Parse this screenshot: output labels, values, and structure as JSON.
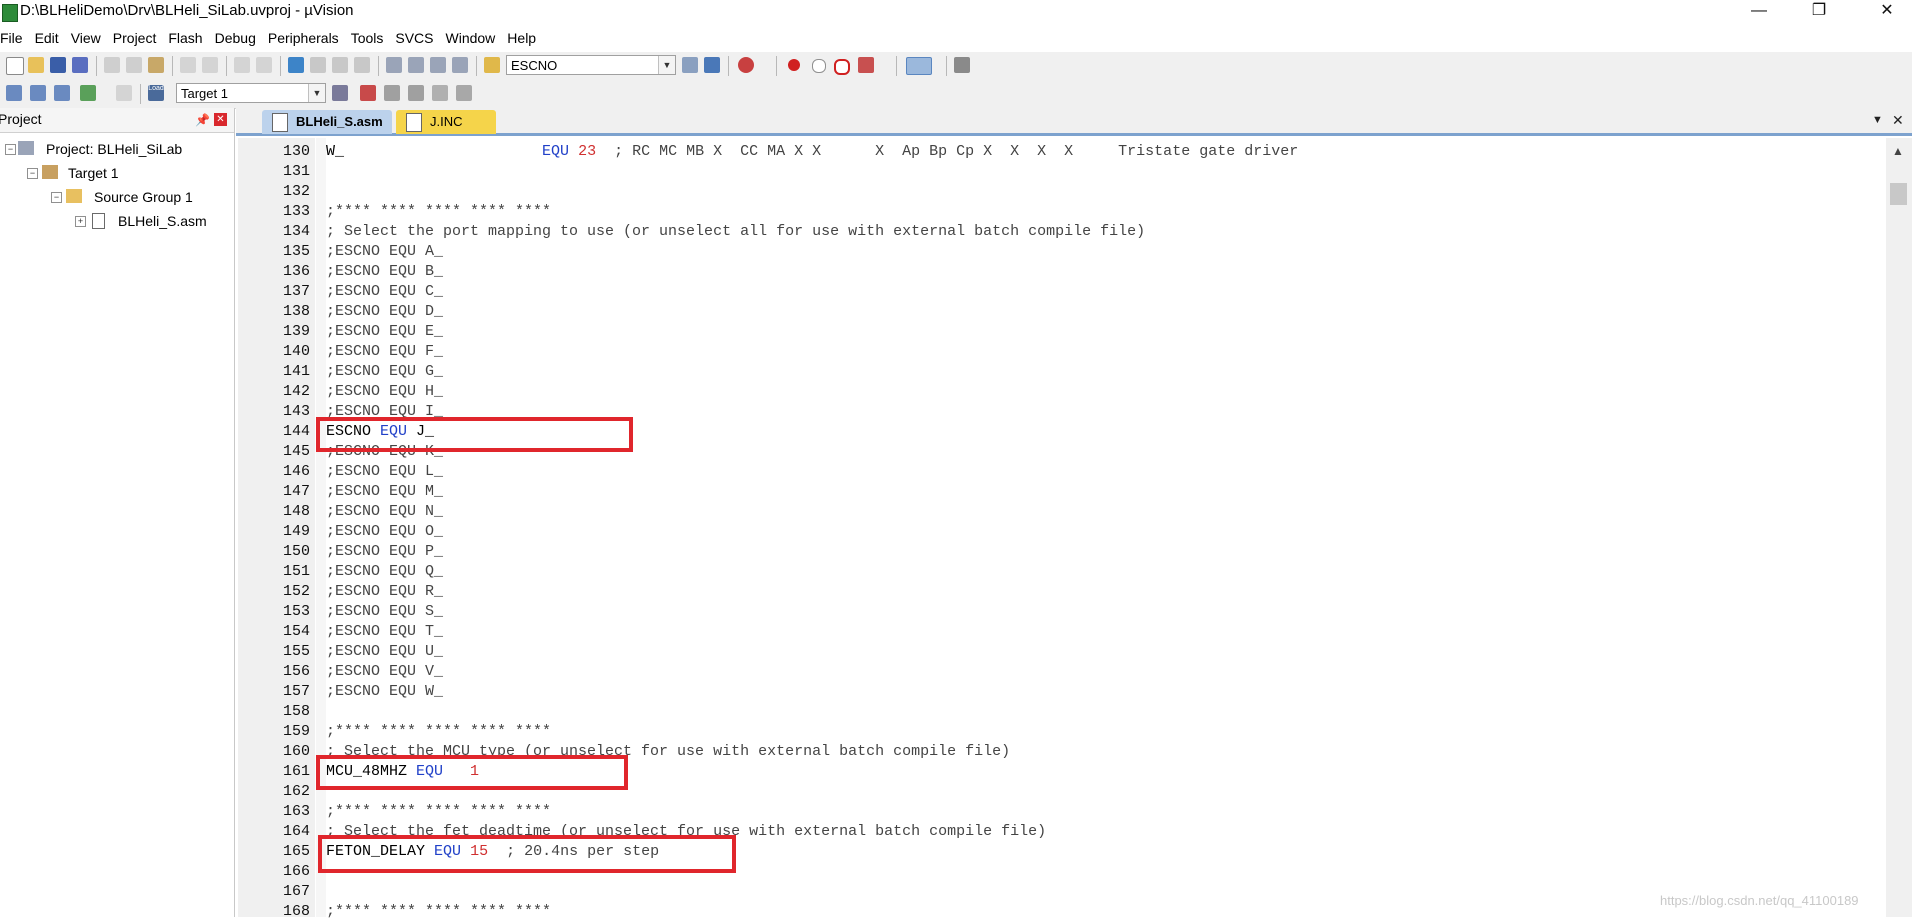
{
  "title": "D:\\BLHeliDemo\\Drv\\BLHeli_SiLab.uvproj - µVision",
  "window_controls": {
    "minimize": "—",
    "maximize": "❐",
    "close": "✕"
  },
  "menu": [
    "File",
    "Edit",
    "View",
    "Project",
    "Flash",
    "Debug",
    "Peripherals",
    "Tools",
    "SVCS",
    "Window",
    "Help"
  ],
  "toolbar1": {
    "find_combo_value": "ESCNO"
  },
  "toolbar2": {
    "load_label": "Load",
    "target_combo_value": "Target 1"
  },
  "project_panel": {
    "title": "Project",
    "pin_icon": "pin-icon",
    "close": "✕",
    "tree": [
      {
        "label": "Project: BLHeli_SiLab",
        "expander": "−"
      },
      {
        "label": "Target 1",
        "expander": "−"
      },
      {
        "label": "Source Group 1",
        "expander": "−"
      },
      {
        "label": "BLHeli_S.asm",
        "expander": "+"
      }
    ]
  },
  "tabs": [
    {
      "label": "BLHeli_S.asm",
      "active": true
    },
    {
      "label": "J.INC",
      "active": false
    }
  ],
  "tab_controls": {
    "dropdown": "▼",
    "close": "✕"
  },
  "code_lines": [
    {
      "n": "130",
      "segs": [
        {
          "t": "W_                      ",
          "c": ""
        },
        {
          "t": "EQU",
          "c": "kw"
        },
        {
          "t": " ",
          "c": ""
        },
        {
          "t": "23",
          "c": "num"
        },
        {
          "t": "  ; RC MC MB X  CC MA X X      X  Ap Bp Cp X  X  X  X     Tristate gate driver",
          "c": "cmt"
        }
      ]
    },
    {
      "n": "131",
      "segs": []
    },
    {
      "n": "132",
      "segs": []
    },
    {
      "n": "133",
      "segs": [
        {
          "t": ";**** **** **** **** ****",
          "c": "cmt"
        }
      ]
    },
    {
      "n": "134",
      "segs": [
        {
          "t": "; Select the port mapping to use (or unselect all for use with external batch compile file)",
          "c": "cmt"
        }
      ]
    },
    {
      "n": "135",
      "segs": [
        {
          "t": ";ESCNO EQU A_",
          "c": "cmt"
        }
      ]
    },
    {
      "n": "136",
      "segs": [
        {
          "t": ";ESCNO EQU B_",
          "c": "cmt"
        }
      ]
    },
    {
      "n": "137",
      "segs": [
        {
          "t": ";ESCNO EQU C_",
          "c": "cmt"
        }
      ]
    },
    {
      "n": "138",
      "segs": [
        {
          "t": ";ESCNO EQU D_",
          "c": "cmt"
        }
      ]
    },
    {
      "n": "139",
      "segs": [
        {
          "t": ";ESCNO EQU E_",
          "c": "cmt"
        }
      ]
    },
    {
      "n": "140",
      "segs": [
        {
          "t": ";ESCNO EQU F_",
          "c": "cmt"
        }
      ]
    },
    {
      "n": "141",
      "segs": [
        {
          "t": ";ESCNO EQU G_",
          "c": "cmt"
        }
      ]
    },
    {
      "n": "142",
      "segs": [
        {
          "t": ";ESCNO EQU H_",
          "c": "cmt"
        }
      ]
    },
    {
      "n": "143",
      "segs": [
        {
          "t": ";ESCNO EQU I_",
          "c": "cmt"
        }
      ]
    },
    {
      "n": "144",
      "segs": [
        {
          "t": "ESCNO ",
          "c": ""
        },
        {
          "t": "EQU",
          "c": "kw"
        },
        {
          "t": " J_",
          "c": ""
        }
      ]
    },
    {
      "n": "145",
      "segs": [
        {
          "t": ";ESCNO EQU K_",
          "c": "cmt"
        }
      ]
    },
    {
      "n": "146",
      "segs": [
        {
          "t": ";ESCNO EQU L_",
          "c": "cmt"
        }
      ]
    },
    {
      "n": "147",
      "segs": [
        {
          "t": ";ESCNO EQU M_",
          "c": "cmt"
        }
      ]
    },
    {
      "n": "148",
      "segs": [
        {
          "t": ";ESCNO EQU N_",
          "c": "cmt"
        }
      ]
    },
    {
      "n": "149",
      "segs": [
        {
          "t": ";ESCNO EQU O_",
          "c": "cmt"
        }
      ]
    },
    {
      "n": "150",
      "segs": [
        {
          "t": ";ESCNO EQU P_",
          "c": "cmt"
        }
      ]
    },
    {
      "n": "151",
      "segs": [
        {
          "t": ";ESCNO EQU Q_",
          "c": "cmt"
        }
      ]
    },
    {
      "n": "152",
      "segs": [
        {
          "t": ";ESCNO EQU R_",
          "c": "cmt"
        }
      ]
    },
    {
      "n": "153",
      "segs": [
        {
          "t": ";ESCNO EQU S_",
          "c": "cmt"
        }
      ]
    },
    {
      "n": "154",
      "segs": [
        {
          "t": ";ESCNO EQU T_",
          "c": "cmt"
        }
      ]
    },
    {
      "n": "155",
      "segs": [
        {
          "t": ";ESCNO EQU U_",
          "c": "cmt"
        }
      ]
    },
    {
      "n": "156",
      "segs": [
        {
          "t": ";ESCNO EQU V_",
          "c": "cmt"
        }
      ]
    },
    {
      "n": "157",
      "segs": [
        {
          "t": ";ESCNO EQU W_",
          "c": "cmt"
        }
      ]
    },
    {
      "n": "158",
      "segs": []
    },
    {
      "n": "159",
      "segs": [
        {
          "t": ";**** **** **** **** ****",
          "c": "cmt"
        }
      ]
    },
    {
      "n": "160",
      "segs": [
        {
          "t": "; Select the MCU type (or unselect for use with external batch compile file)",
          "c": "cmt"
        }
      ]
    },
    {
      "n": "161",
      "segs": [
        {
          "t": "MCU_48MHZ ",
          "c": ""
        },
        {
          "t": "EQU",
          "c": "kw"
        },
        {
          "t": "   ",
          "c": ""
        },
        {
          "t": "1",
          "c": "num"
        }
      ]
    },
    {
      "n": "162",
      "segs": []
    },
    {
      "n": "163",
      "segs": [
        {
          "t": ";**** **** **** **** ****",
          "c": "cmt"
        }
      ]
    },
    {
      "n": "164",
      "segs": [
        {
          "t": "; Select the fet deadtime (or unselect for use with external batch compile file)",
          "c": "cmt"
        }
      ]
    },
    {
      "n": "165",
      "segs": [
        {
          "t": "FETON_DELAY ",
          "c": ""
        },
        {
          "t": "EQU",
          "c": "kw"
        },
        {
          "t": " ",
          "c": ""
        },
        {
          "t": "15",
          "c": "num"
        },
        {
          "t": "  ; 20.4ns per step",
          "c": "cmt"
        }
      ]
    },
    {
      "n": "166",
      "segs": []
    },
    {
      "n": "167",
      "segs": []
    },
    {
      "n": "168",
      "segs": [
        {
          "t": ";**** **** **** **** ****",
          "c": "cmt"
        }
      ]
    }
  ],
  "watermark": "https://blog.csdn.net/qq_41100189"
}
